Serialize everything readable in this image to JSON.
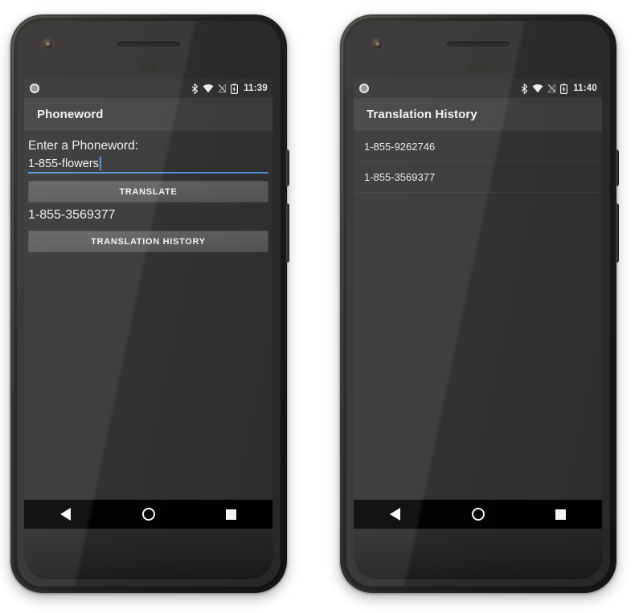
{
  "phones": [
    {
      "id": "phoneword-app",
      "status_bar": {
        "notification_icon": "circle-notification-icon",
        "icons": [
          "bluetooth-icon",
          "wifi-icon",
          "mobile-signal-off-icon",
          "battery-charging-icon"
        ],
        "clock": "11:39"
      },
      "action_bar": {
        "title": "Phoneword"
      },
      "content": {
        "field_label": "Enter a Phoneword:",
        "input_value": "1-855-flowers",
        "input_placeholder": "Enter a Phoneword",
        "translate_button": "TRANSLATE",
        "result": "1-855-3569377",
        "history_button": "TRANSLATION HISTORY"
      },
      "nav_bar": {
        "back": "back-icon",
        "home": "home-icon",
        "recents": "recents-icon"
      }
    },
    {
      "id": "translation-history-app",
      "status_bar": {
        "notification_icon": "circle-notification-icon",
        "icons": [
          "bluetooth-icon",
          "wifi-icon",
          "mobile-signal-off-icon",
          "battery-charging-icon"
        ],
        "clock": "11:40"
      },
      "action_bar": {
        "title": "Translation History"
      },
      "content": {
        "list": [
          "1-855-9262746",
          "1-855-3569377"
        ]
      },
      "nav_bar": {
        "back": "back-icon",
        "home": "home-icon",
        "recents": "recents-icon"
      }
    }
  ],
  "colors": {
    "screen_background": "#303030",
    "action_bar": "#3c3c3c",
    "button": "#5c5c5c",
    "accent_underline": "#4a90d9",
    "nav_bar": "#000000",
    "text_primary": "#f0f0f0",
    "divider": "#3a3a3a"
  }
}
